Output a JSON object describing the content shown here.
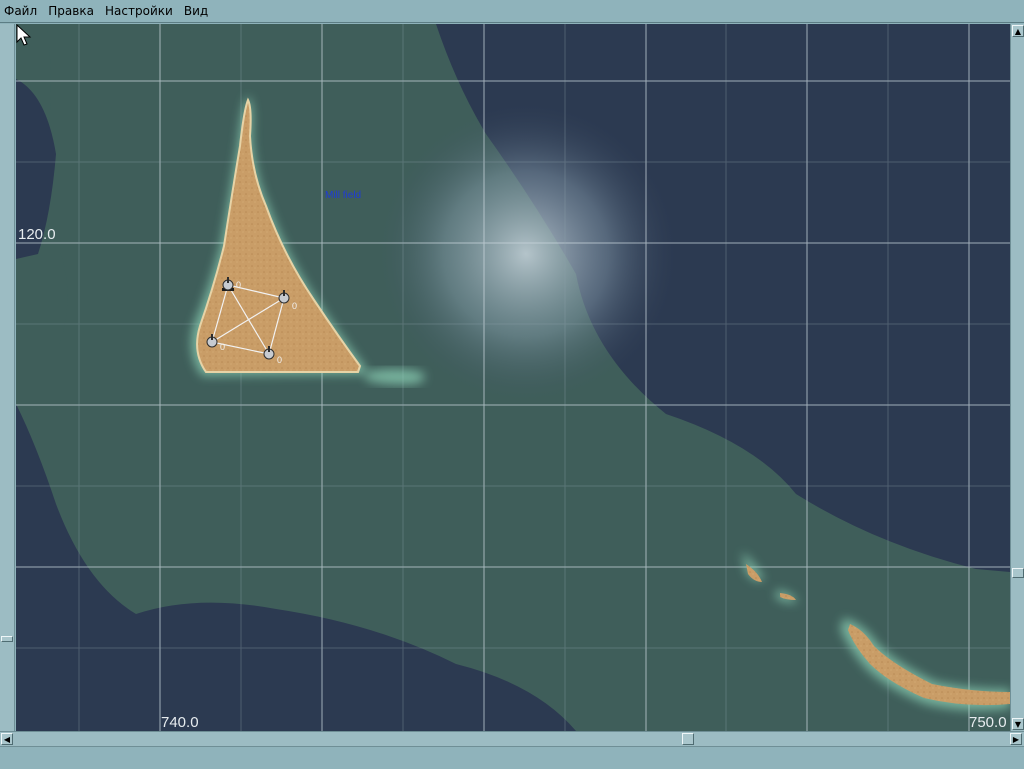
{
  "menu": {
    "items": [
      "Файл",
      "Правка",
      "Настройки",
      "Вид"
    ]
  },
  "map": {
    "grid_labels": {
      "y_label": "120.0",
      "x_label_left": "740.0",
      "x_label_right": "750.0"
    },
    "minefield_label": "Mill field",
    "units": [
      "0",
      "0",
      "0",
      "0"
    ]
  },
  "colors": {
    "deep_water": "#2c3a51",
    "shallow_water": "#3f5e5a",
    "sand": "#c99d67",
    "grid": "#c9d5dc",
    "ui_chrome": "#8fb3bb"
  },
  "icons": [
    "cursor-arrow-icon",
    "fortification-icon",
    "scroll-arrow-icon"
  ]
}
